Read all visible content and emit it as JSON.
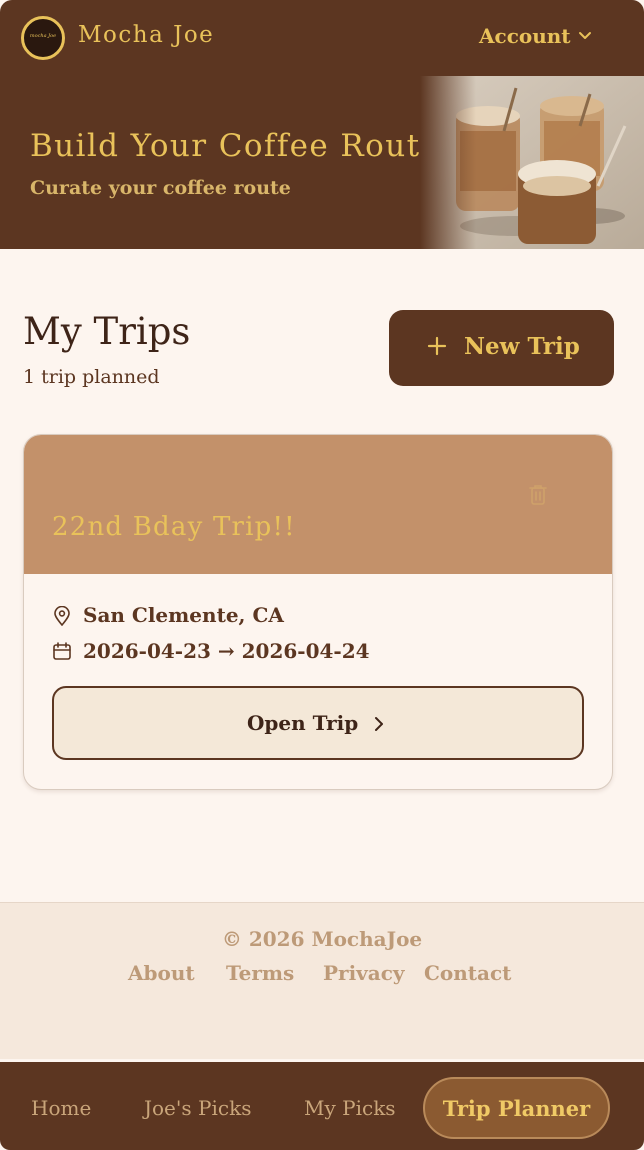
{
  "header": {
    "brand": "Mocha Joe",
    "logo_text": "mocha Joe",
    "account_label": "Account",
    "accent": "#e9c25a",
    "background": "#5c3621"
  },
  "hero": {
    "title": "Build Your Coffee Route",
    "subtitle": "Curate your coffee route"
  },
  "trips_section": {
    "title": "My Trips",
    "count_text": "1 trip planned",
    "new_trip_label": "New Trip"
  },
  "trips": [
    {
      "title": "22nd Bday Trip!!",
      "location": "San Clemente, CA",
      "dates": "2026-04-23 → 2026-04-24",
      "open_label": "Open Trip",
      "header_color": "#c3916a"
    }
  ],
  "footer": {
    "copyright": "© 2026 MochaJoe",
    "links": [
      "About",
      "Terms",
      "Privacy",
      "Contact"
    ]
  },
  "bottom_nav": {
    "items": [
      "Home",
      "Joe's Picks",
      "My Picks",
      "Trip Planner"
    ],
    "active": "Trip Planner"
  }
}
